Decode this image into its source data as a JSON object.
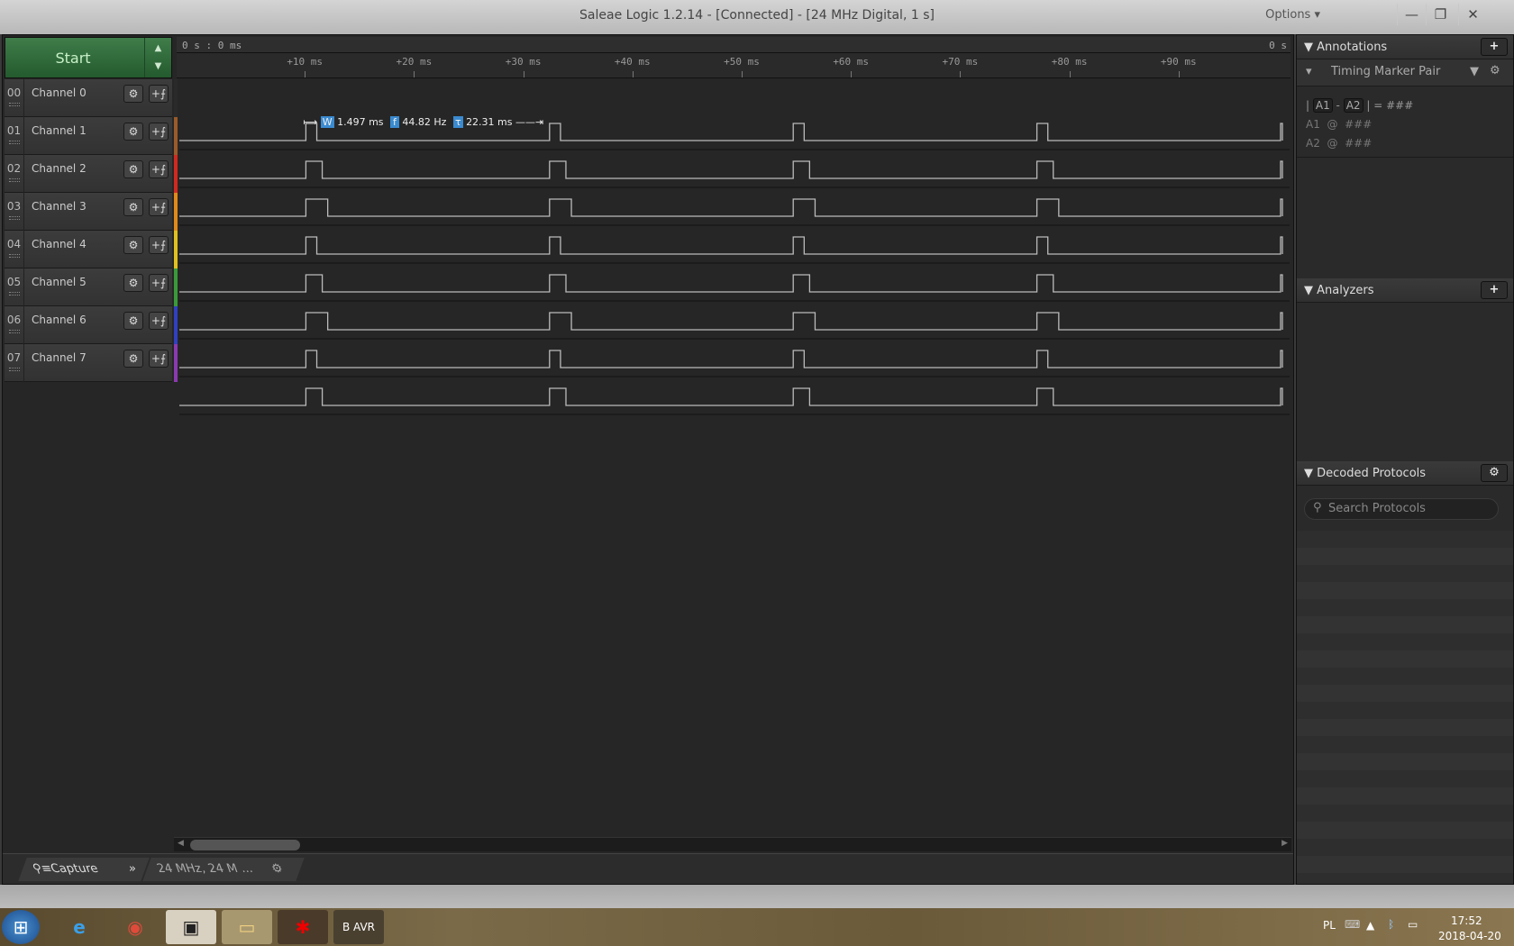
{
  "window": {
    "title": "Saleae Logic 1.2.14 - [Connected] - [24 MHz Digital, 1 s]",
    "options": "Options ▾",
    "minimize": "—",
    "restore": "❐",
    "close": "✕"
  },
  "start": {
    "label": "Start",
    "up": "▲",
    "down": "▼"
  },
  "ruler": {
    "origin": "0 s : 0 ms",
    "end": "0 s",
    "ticks": [
      "+10 ms",
      "+20 ms",
      "+30 ms",
      "+40 ms",
      "+50 ms",
      "+60 ms",
      "+70 ms",
      "+80 ms",
      "+90 ms"
    ]
  },
  "channels": [
    {
      "num": "00",
      "name": "Channel 0",
      "color": "#2a2a2a",
      "pulse_ms": 1.0
    },
    {
      "num": "01",
      "name": "Channel 1",
      "color": "#9a5a2a",
      "pulse_ms": 1.497
    },
    {
      "num": "02",
      "name": "Channel 2",
      "color": "#d02a20",
      "pulse_ms": 2.0
    },
    {
      "num": "03",
      "name": "Channel 3",
      "color": "#e08a1a",
      "pulse_ms": 1.0
    },
    {
      "num": "04",
      "name": "Channel 4",
      "color": "#e0c020",
      "pulse_ms": 1.5
    },
    {
      "num": "05",
      "name": "Channel 5",
      "color": "#3a9a3a",
      "pulse_ms": 2.0
    },
    {
      "num": "06",
      "name": "Channel 6",
      "color": "#3040c0",
      "pulse_ms": 1.0
    },
    {
      "num": "07",
      "name": "Channel 7",
      "color": "#8a3ab0",
      "pulse_ms": 1.5
    }
  ],
  "waveform": {
    "first_pulse_ms": 10.1,
    "period_ms": 22.31,
    "visible_ms": 101.5
  },
  "measurement": {
    "width": "1.497 ms",
    "freq": "44.82 Hz",
    "period": "22.31 ms",
    "w_icon": "W",
    "f_icon": "f",
    "t_icon": "τ"
  },
  "annotations": {
    "title": "Annotations",
    "add": "+",
    "marker": "Timing Marker Pair",
    "formula": {
      "a1": "A1",
      "dash": "-",
      "a2": "A2",
      "eq": "= ###"
    },
    "rows": [
      {
        "label": "A1",
        "at": "@",
        "value": "###"
      },
      {
        "label": "A2",
        "at": "@",
        "value": "###"
      }
    ]
  },
  "analyzers": {
    "title": "Analyzers",
    "add": "+"
  },
  "decoded": {
    "title": "Decoded Protocols",
    "search_placeholder": "Search Protocols"
  },
  "bottom": {
    "capture": "Capture",
    "more": "»",
    "device": "24 MHz, 24 M ..."
  },
  "tray": {
    "lang": "PL",
    "time": "17:52",
    "date": "2018-04-20"
  }
}
